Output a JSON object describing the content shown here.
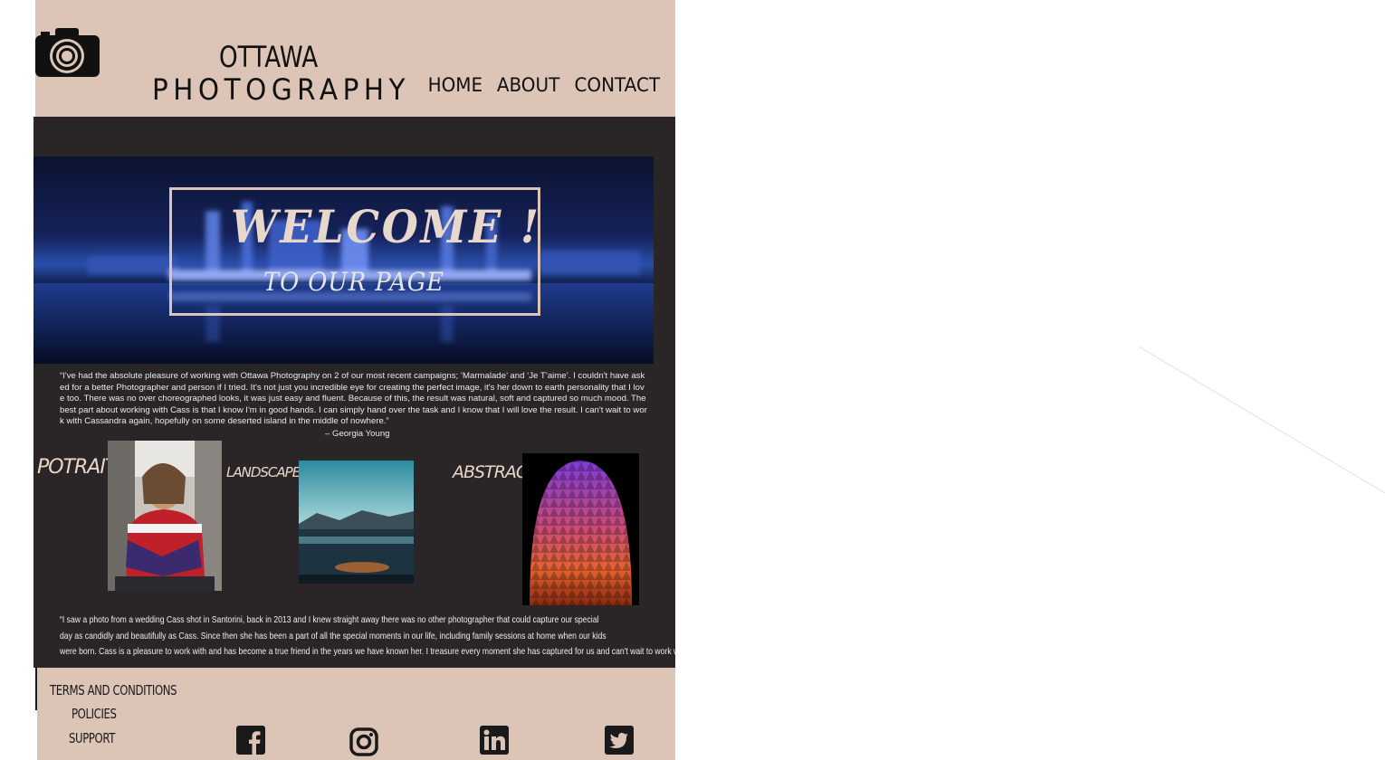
{
  "brand": {
    "line1": "OTTAWA",
    "line2": "PHOTOGRAPHY",
    "logo_icon": "camera-icon"
  },
  "nav": {
    "home": "HOME",
    "about": "ABOUT",
    "contact": "CONTACT"
  },
  "hero": {
    "title": "WELCOME !",
    "subtitle": "TO OUR PAGE"
  },
  "testimonial_1": {
    "text": "“I've had the absolute pleasure of working with Ottawa Photography on 2 of our most recent campaigns; ‘Marmalade’ and ‘Je T’aime’. I couldn't have asked for a better Photographer and person if I tried. It's not just you incredible eye for creating the perfect image, it's her down to earth personality that I love too. There was no over choreographed looks, it was just easy and fluent. Because of this, the result was natural, soft and captured so much mood. The best part about working with Cass is that I know I'm in good hands. I can simply hand over the task and I know that I will love the result. I can't wait to work with Cassandra again, hopefully on some deserted island in the middle of nowhere.”",
    "author": "– Georgia Young"
  },
  "categories": {
    "portraits": "POTRAITS",
    "landscapes": "LANDSCAPES",
    "abstracts": "ABSTRACTS"
  },
  "testimonial_2": {
    "line1": "“I saw a photo from a wedding Cass shot in Santorini, back in 2013 and I knew straight away there was no other photographer that could capture our special",
    "line2": "day as candidly and beautifully as Cass. Since then she has been a part of all the special moments in our life, including family sessions at home when our kids",
    "line3": "were born. Cass is a pleasure to work with and has become a true friend in the years we have known her. I treasure every moment she has captured for us and can't wait to work with her again.”"
  },
  "footer": {
    "terms": "TERMS AND CONDITIONS",
    "policies": "POLICIES",
    "support": "SUPPORT",
    "social_icons": [
      "facebook-icon",
      "instagram-icon",
      "linkedin-icon",
      "twitter-icon"
    ]
  },
  "colors": {
    "header_bg": "#dcc5b6",
    "main_bg": "#2a2526",
    "accent_text": "#e9d6c8"
  }
}
